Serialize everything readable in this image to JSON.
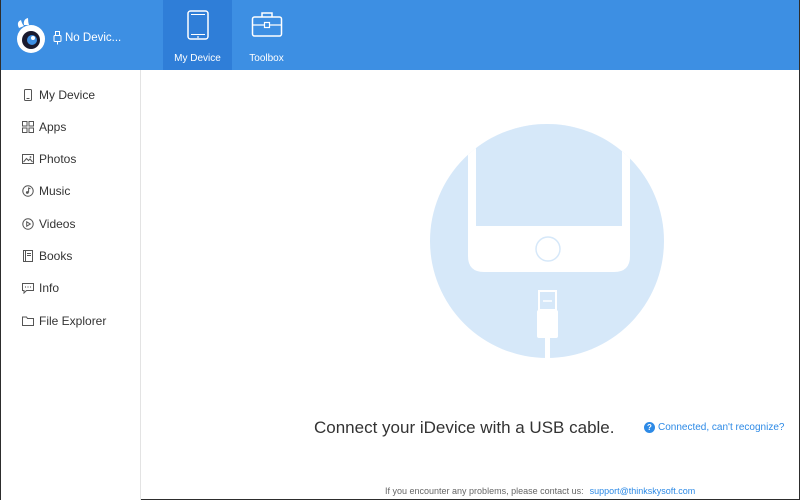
{
  "header": {
    "device_status": "No Devic...",
    "tabs": [
      {
        "id": "my-device",
        "label": "My Device",
        "icon": "tablet-icon",
        "active": true
      },
      {
        "id": "toolbox",
        "label": "Toolbox",
        "icon": "toolbox-icon",
        "active": false
      }
    ]
  },
  "sidebar": {
    "items": [
      {
        "label": "My Device",
        "icon": "phone-icon"
      },
      {
        "label": "Apps",
        "icon": "apps-grid-icon"
      },
      {
        "label": "Photos",
        "icon": "photo-icon"
      },
      {
        "label": "Music",
        "icon": "music-icon"
      },
      {
        "label": "Videos",
        "icon": "video-icon"
      },
      {
        "label": "Books",
        "icon": "book-icon"
      },
      {
        "label": "Info",
        "icon": "chat-icon"
      },
      {
        "label": "File Explorer",
        "icon": "folder-icon"
      }
    ]
  },
  "main": {
    "connect_message": "Connect your iDevice with a USB cable.",
    "help_link": "Connected, can't recognize?",
    "footer_text": "If you encounter any problems, please contact us:",
    "support_email": "support@thinkskysoft.com"
  },
  "colors": {
    "header_bg": "#3d8fe3",
    "active_tab_bg": "#2f7ed8",
    "hero_circle": "#d6e8f9",
    "link": "#2d8ae6"
  }
}
